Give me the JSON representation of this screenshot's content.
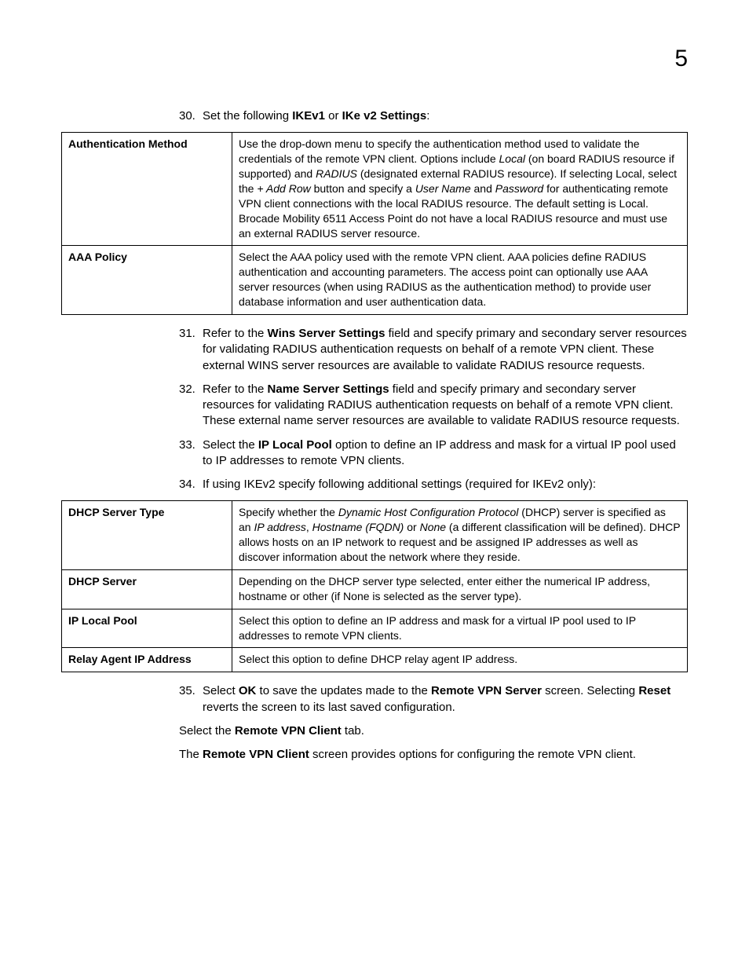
{
  "page_number": "5",
  "steps": {
    "s30": {
      "num": "30.",
      "pre": "Set the following ",
      "b1": "IKEv1",
      "mid": " or ",
      "b2": "IKe v2 Settings",
      "post": ":"
    },
    "s31": {
      "num": "31.",
      "pre": "Refer to the ",
      "b1": "Wins Server Settings",
      "post": " field and specify primary and secondary server resources for validating RADIUS authentication requests on behalf of a remote VPN client. These external WINS server resources are available to validate RADIUS resource requests."
    },
    "s32": {
      "num": "32.",
      "pre": "Refer to the ",
      "b1": "Name Server Settings",
      "post": " field and specify primary and secondary server resources for validating RADIUS authentication requests on behalf of a remote VPN client. These external name server resources are available to validate RADIUS resource requests."
    },
    "s33": {
      "num": "33.",
      "pre": "Select the ",
      "b1": "IP Local Pool",
      "post": " option to define an IP address and mask for a virtual IP pool used to IP addresses to remote VPN clients."
    },
    "s34": {
      "num": "34.",
      "text": "If using IKEv2 specify following additional settings (required for IKEv2 only):"
    },
    "s35": {
      "num": "35.",
      "pre": "Select ",
      "b1": "OK",
      "mid1": " to save the updates made to the ",
      "b2": "Remote VPN Server",
      "mid2": " screen. Selecting ",
      "b3": "Reset",
      "post": " reverts the screen to its last saved configuration."
    }
  },
  "extras": {
    "line1_pre": "Select the ",
    "line1_b": "Remote VPN Client",
    "line1_post": " tab.",
    "line2_pre": "The ",
    "line2_b": "Remote VPN Client",
    "line2_post": " screen provides options for configuring the remote VPN client."
  },
  "table1": {
    "r1_term": "Authentication Method",
    "r1_p1": "Use the drop-down menu to specify the authentication method used to validate the credentials of the remote VPN client. Options include ",
    "r1_i1": "Local",
    "r1_p2": " (on board RADIUS resource if supported) and ",
    "r1_i2": "RADIUS",
    "r1_p3": " (designated external RADIUS resource). If selecting Local, select the ",
    "r1_i3": "+ Add Row",
    "r1_p4": " button and specify a ",
    "r1_i4": "User Name",
    "r1_p5": " and ",
    "r1_i5": "Password",
    "r1_p6": " for authenticating remote VPN client connections with the local RADIUS resource. The default setting is Local. Brocade Mobility 6511 Access Point do not have a local RADIUS resource and must use an external RADIUS server resource.",
    "r2_term": "AAA Policy",
    "r2_desc": "Select the AAA policy used with the remote VPN client. AAA policies define RADIUS authentication and accounting parameters. The access point can optionally use AAA server resources (when using RADIUS as the authentication method) to provide user database information and user authentication data."
  },
  "table2": {
    "r1_term": "DHCP Server Type",
    "r1_p1": "Specify whether the ",
    "r1_i1": "Dynamic Host Configuration Protocol",
    "r1_p2": " (DHCP) server is specified as an ",
    "r1_i2": "IP address",
    "r1_p3": ", ",
    "r1_i3": "Hostname (FQDN)",
    "r1_p4": " or ",
    "r1_i4": "None",
    "r1_p5": " (a different classification will be defined). DHCP allows hosts on an IP network to request and be assigned IP addresses as well as discover information about the network where they reside.",
    "r2_term": "DHCP Server",
    "r2_desc": "Depending on the DHCP server type selected, enter either the numerical IP address, hostname or other (if None is selected as the server type).",
    "r3_term": "IP Local Pool",
    "r3_desc": "Select this option to define an IP address and mask for a virtual IP pool used to IP addresses to remote VPN clients.",
    "r4_term": "Relay Agent IP Address",
    "r4_desc": "Select this option to define DHCP relay agent IP address."
  }
}
